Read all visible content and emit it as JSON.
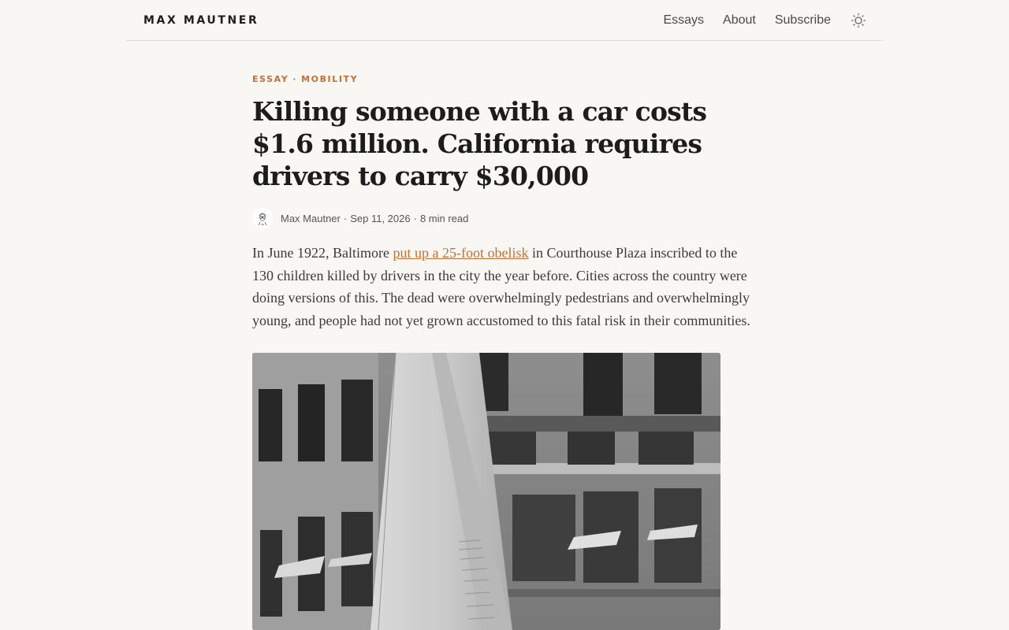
{
  "site": {
    "brand": "MAX MAUTNER",
    "nav": [
      "Essays",
      "About",
      "Subscribe"
    ],
    "theme_toggle_icon": "sun-icon"
  },
  "article": {
    "kicker": {
      "category": "ESSAY",
      "separator": "·",
      "topic": "MOBILITY"
    },
    "title": "Killing someone with a car costs $1.6 million. California requires drivers to carry $30,000",
    "byline": {
      "author": "Max Mautner",
      "separator": "·",
      "date": "Sep 11, 2026",
      "read_time": "8 min read",
      "avatar_icon": "avatar-sketch-icon"
    },
    "lede": {
      "before_link": "In June 1922, Baltimore ",
      "link_text": "put up a 25-foot obelisk",
      "after_link": " in Courthouse Plaza inscribed to the 130 children killed by drivers in the city the year before. Cities across the country were doing versions of this. The dead were overwhelmingly pedestrians and overwhelmingly young, and people had not yet grown accustomed to this fatal risk in their communities."
    },
    "photo_icon": "obelisk-photo"
  },
  "colors": {
    "accent": "#c0703a",
    "background": "#f8f7f3",
    "text": "#1e1e1e"
  }
}
